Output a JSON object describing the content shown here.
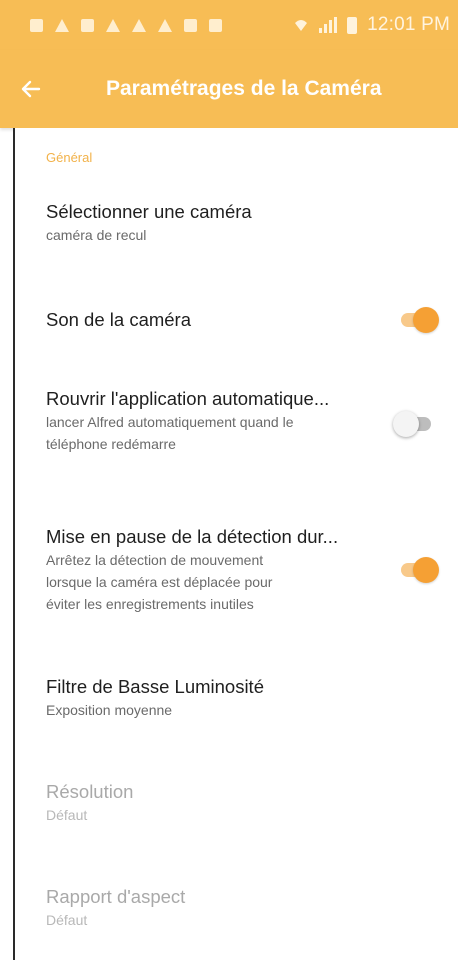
{
  "status_bar": {
    "time": "12:01 PM",
    "icons": [
      "notification-icon",
      "alert-icon",
      "video-icon",
      "warning-icon",
      "warning-icon",
      "warning-icon",
      "mail-icon",
      "screenshot-icon",
      "wifi-icon",
      "signal-icon",
      "battery-icon"
    ]
  },
  "app_bar": {
    "back_icon": "back-arrow-icon",
    "title": "Paramétrages de la Caméra"
  },
  "settings": {
    "section_general": "Général",
    "select_camera": {
      "title": "Sélectionner une caméra",
      "summary": "caméra de recul"
    },
    "camera_sound": {
      "title": "Son de la caméra",
      "enabled": true
    },
    "auto_reopen": {
      "title": "Rouvrir l'application automatique...",
      "summary_line1": "lancer Alfred automatiquement quand le",
      "summary_line2": "téléphone redémarre",
      "enabled": false
    },
    "pause_detection": {
      "title": "Mise en pause de la détection dur...",
      "summary_line1": "Arrêtez la détection de mouvement",
      "summary_line2": "lorsque la caméra est déplacée pour",
      "summary_line3": "éviter les enregistrements inutiles",
      "enabled": true
    },
    "low_light_filter": {
      "title": "Filtre de Basse Luminosité",
      "summary": "Exposition moyenne"
    },
    "resolution": {
      "title": "Résolution",
      "summary": "Défaut",
      "disabled": true
    },
    "aspect_ratio": {
      "title": "Rapport d'aspect",
      "summary": "Défaut",
      "disabled": true
    }
  },
  "colors": {
    "accent": "#f7bd55",
    "toggle_on": "#f5a034",
    "toggle_off": "#f4f4f4",
    "section_header": "#f2b24a"
  }
}
